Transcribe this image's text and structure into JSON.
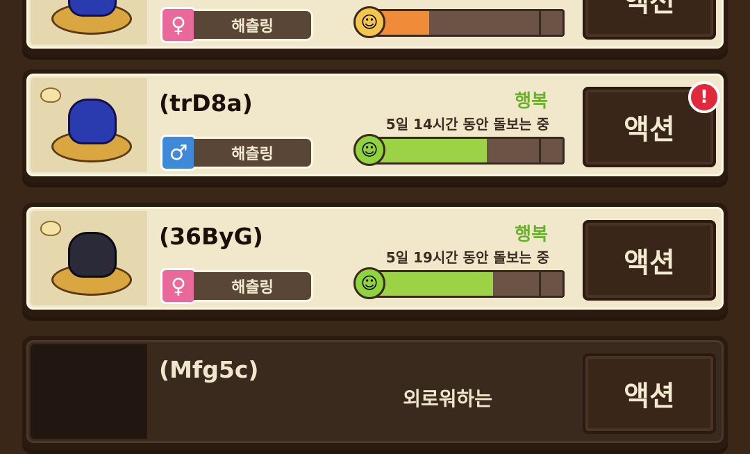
{
  "pets": [
    {
      "name": "",
      "gender": "female",
      "gender_symbol": "♀",
      "stage": "해츨링",
      "mood": "",
      "care_text": "",
      "bar_fill": 0.33,
      "bar_color": "#f08b3a",
      "face": "☺",
      "face_color": "#f6c64c",
      "action_label": "액션",
      "alert": false
    },
    {
      "name": "(trD8a)",
      "gender": "male",
      "gender_symbol": "♂",
      "stage": "해츨링",
      "mood": "행복",
      "care_text": "5일 14시간 동안 돌보는 중",
      "bar_fill": 0.62,
      "bar_color": "#9cd246",
      "face": "☺",
      "face_color": "#8fd33e",
      "action_label": "액션",
      "alert": true,
      "alert_symbol": "!"
    },
    {
      "name": "(36ByG)",
      "gender": "female",
      "gender_symbol": "♀",
      "stage": "해츨링",
      "mood": "행복",
      "care_text": "5일 19시간 동안 돌보는 중",
      "bar_fill": 0.65,
      "bar_color": "#9cd246",
      "face": "☺",
      "face_color": "#8fd33e",
      "action_label": "액션",
      "alert": false
    },
    {
      "name": "(Mfg5c)",
      "gender": "",
      "stage": "",
      "mood": "",
      "care_text": "외로워하는",
      "action_label": "액션",
      "alert": false
    }
  ]
}
